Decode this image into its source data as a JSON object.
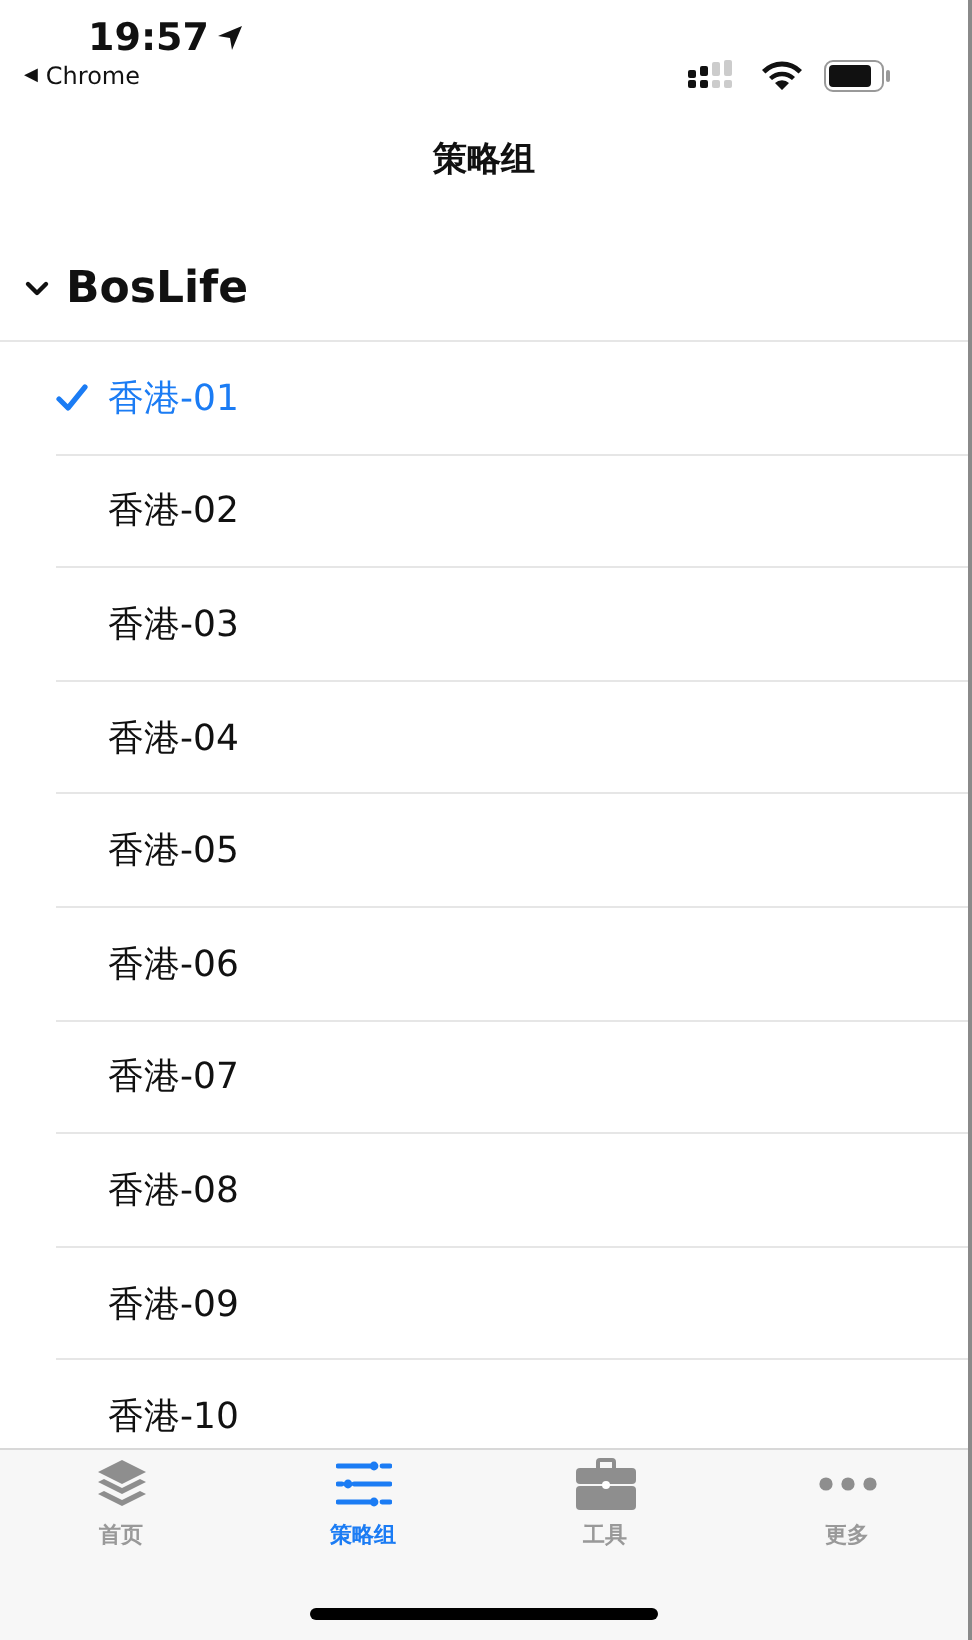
{
  "status_bar": {
    "time": "19:57",
    "back_arrow": "◀",
    "back_label": "Chrome"
  },
  "nav": {
    "title": "策略组"
  },
  "group": {
    "name": "BosLife",
    "expanded": true,
    "items": [
      {
        "label": "香港-01",
        "selected": true
      },
      {
        "label": "香港-02",
        "selected": false
      },
      {
        "label": "香港-03",
        "selected": false
      },
      {
        "label": "香港-04",
        "selected": false
      },
      {
        "label": "香港-05",
        "selected": false
      },
      {
        "label": "香港-06",
        "selected": false
      },
      {
        "label": "香港-07",
        "selected": false
      },
      {
        "label": "香港-08",
        "selected": false
      },
      {
        "label": "香港-09",
        "selected": false
      },
      {
        "label": "香港-10",
        "selected": false
      }
    ]
  },
  "tab_bar": [
    {
      "kind": "layers",
      "label": "首页",
      "selected": false
    },
    {
      "kind": "sliders",
      "label": "策略组",
      "selected": true
    },
    {
      "kind": "toolbox",
      "label": "工具",
      "selected": false
    },
    {
      "kind": "more",
      "label": "更多",
      "selected": false
    }
  ]
}
